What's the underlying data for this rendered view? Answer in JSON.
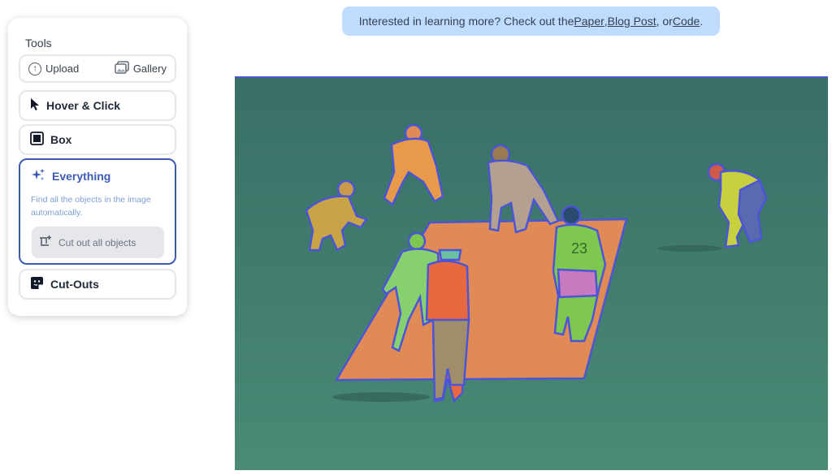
{
  "tools": {
    "title": "Tools",
    "upload_label": "Upload",
    "gallery_label": "Gallery",
    "hover_click_label": "Hover & Click",
    "box_label": "Box",
    "everything": {
      "label": "Everything",
      "description": "Find all the objects in the image automatically.",
      "cut_button_label": "Cut out all objects"
    },
    "cutouts_label": "Cut-Outs"
  },
  "banner": {
    "prefix": "Interested in learning more? Check out the ",
    "paper": "Paper",
    "sep1": ", ",
    "blog": "Blog Post",
    "sep2": ", or ",
    "code": "Code",
    "suffix": "."
  },
  "scene": {
    "jersey_number": "23"
  },
  "colors": {
    "accent": "#3b5bb5",
    "banner_bg": "#bfdbfe",
    "field": "#3f7f6f",
    "pitch": "#e08a55",
    "outline": "#4b55d6"
  }
}
